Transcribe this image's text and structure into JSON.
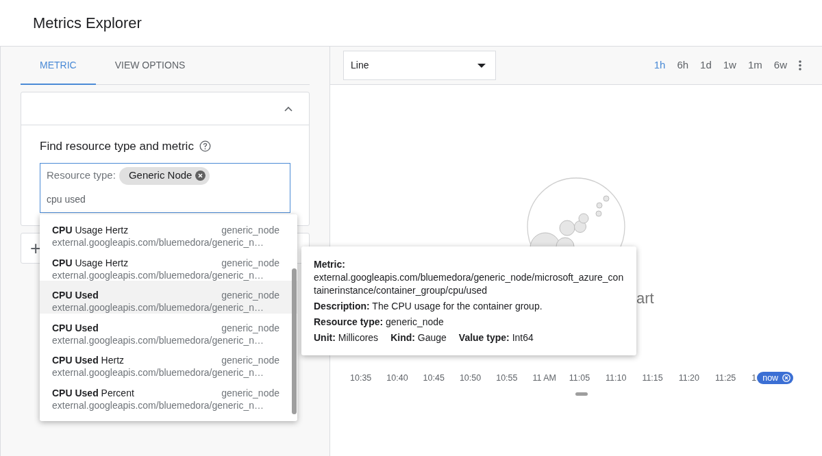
{
  "header": {
    "title": "Metrics Explorer"
  },
  "tabs": [
    {
      "label": "METRIC",
      "selected": true
    },
    {
      "label": "VIEW OPTIONS",
      "selected": false
    }
  ],
  "query_card": {
    "expanded": true,
    "heading": "Find resource type and metric",
    "resource_label": "Resource type:",
    "chip": "Generic Node",
    "query": "cpu used"
  },
  "add_card": {
    "icon": "+"
  },
  "suggestions": [
    {
      "name": "**CPU** Usage Hertz",
      "resource": "generic_node",
      "path": "external.googleapis.com/bluemedora/generic_n…",
      "selected": false
    },
    {
      "name": "**CPU** Usage Hertz",
      "resource": "generic_node",
      "path": "external.googleapis.com/bluemedora/generic_n…",
      "selected": false
    },
    {
      "name": "**CPU Used**",
      "resource": "generic_node",
      "path": "external.googleapis.com/bluemedora/generic_n…",
      "selected": true
    },
    {
      "name": "**CPU Used**",
      "resource": "generic_node",
      "path": "external.googleapis.com/bluemedora/generic_n…",
      "selected": false
    },
    {
      "name": "**CPU Used** Hertz",
      "resource": "generic_node",
      "path": "external.googleapis.com/bluemedora/generic_n…",
      "selected": false
    },
    {
      "name": "**CPU Used** Percent",
      "resource": "generic_node",
      "path": "external.googleapis.com/bluemedora/generic_n…",
      "selected": false
    }
  ],
  "chart_type": {
    "value": "Line"
  },
  "ranges": [
    {
      "label": "1h",
      "selected": true
    },
    {
      "label": "6h",
      "selected": false
    },
    {
      "label": "1d",
      "selected": false
    },
    {
      "label": "1w",
      "selected": false
    },
    {
      "label": "1m",
      "selected": false
    },
    {
      "label": "6w",
      "selected": false
    }
  ],
  "empty_message": "art",
  "time_axis": [
    "10:35",
    "10:40",
    "10:45",
    "10:50",
    "10:55",
    "11 AM",
    "11:05",
    "11:10",
    "11:15",
    "11:20",
    "11:25",
    "1"
  ],
  "now_chip": "now",
  "tooltip": {
    "metric_label": "Metric:",
    "metric": "external.googleapis.com/bluemedora/generic_node/microsoft_azure_containerinstance/container_group/cpu/used",
    "description": "**Description:** The CPU usage for the container group.",
    "resource_type": "**Resource type:** generic_node",
    "facts": [
      "**Unit:** Millicores",
      "**Kind:** Gauge",
      "**Value type:** Int64"
    ]
  }
}
